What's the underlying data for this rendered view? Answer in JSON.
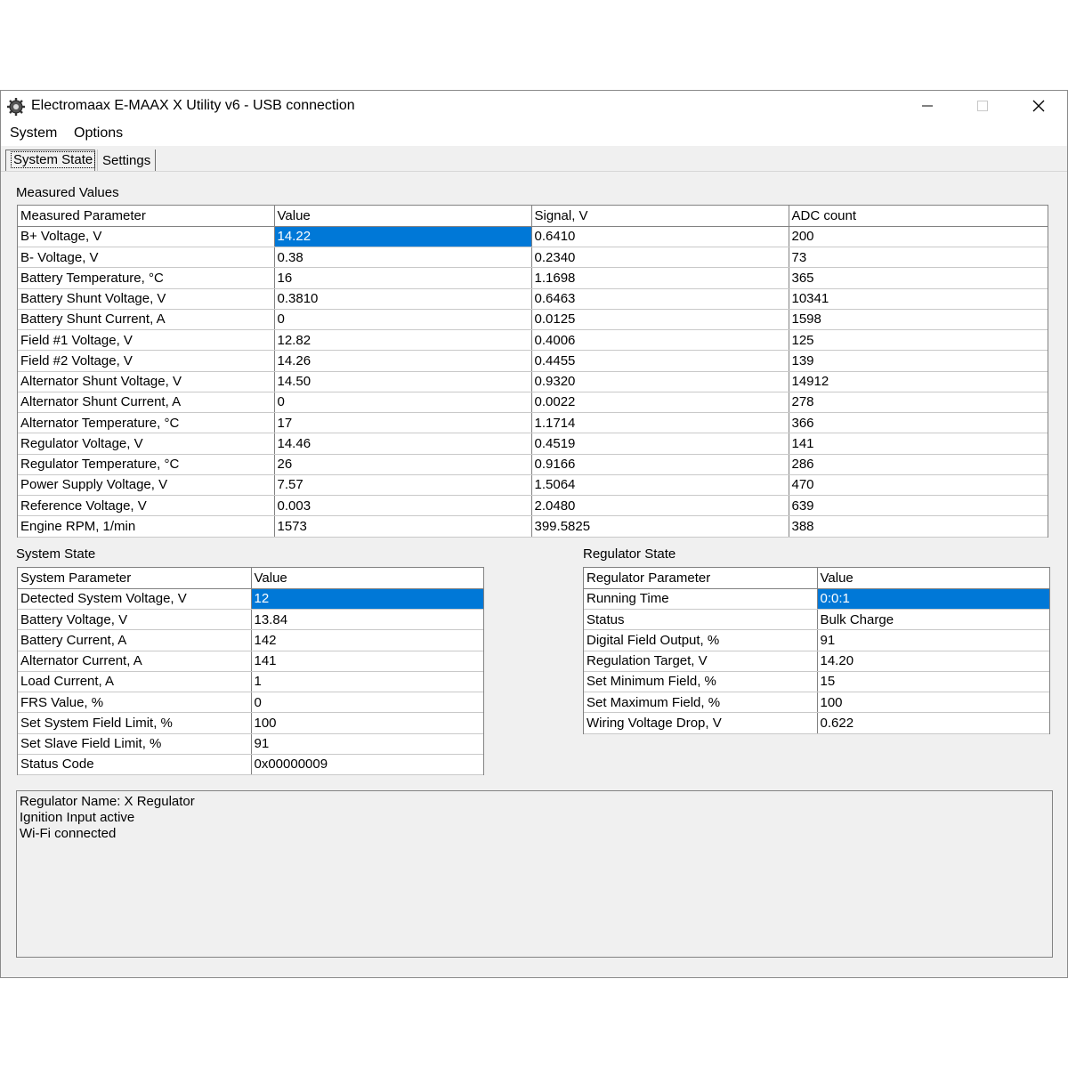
{
  "window": {
    "title": "Electromaax E-MAAX X Utility v6 - USB connection",
    "app_icon": "gear-icon"
  },
  "menu": {
    "items": [
      "System",
      "Options"
    ]
  },
  "tabs": {
    "active": "System State",
    "inactive": "Settings"
  },
  "measured": {
    "label": "Measured Values",
    "headers": [
      "Measured Parameter",
      "Value",
      "Signal, V",
      "ADC count"
    ],
    "rows": [
      [
        "B+ Voltage, V",
        "14.22",
        "0.6410",
        "200"
      ],
      [
        "B- Voltage, V",
        "0.38",
        "0.2340",
        "73"
      ],
      [
        "Battery Temperature, °C",
        "16",
        "1.1698",
        "365"
      ],
      [
        "Battery Shunt Voltage, V",
        "0.3810",
        "0.6463",
        "10341"
      ],
      [
        "Battery Shunt Current, A",
        "0",
        "0.0125",
        "1598"
      ],
      [
        "Field #1 Voltage, V",
        "12.82",
        "0.4006",
        "125"
      ],
      [
        "Field #2 Voltage, V",
        "14.26",
        "0.4455",
        "139"
      ],
      [
        "Alternator Shunt Voltage, V",
        "14.50",
        "0.9320",
        "14912"
      ],
      [
        "Alternator Shunt Current, A",
        "0",
        "0.0022",
        "278"
      ],
      [
        "Alternator Temperature, °C",
        "17",
        "1.1714",
        "366"
      ],
      [
        "Regulator Voltage, V",
        "14.46",
        "0.4519",
        "141"
      ],
      [
        "Regulator Temperature, °C",
        "26",
        "0.9166",
        "286"
      ],
      [
        "Power Supply Voltage, V",
        "7.57",
        "1.5064",
        "470"
      ],
      [
        "Reference Voltage, V",
        "0.003",
        "2.0480",
        "639"
      ],
      [
        "Engine RPM, 1/min",
        "1573",
        "399.5825",
        "388"
      ]
    ]
  },
  "system_state": {
    "label": "System State",
    "headers": [
      "System Parameter",
      "Value"
    ],
    "rows": [
      [
        "Detected System Voltage, V",
        "12"
      ],
      [
        "Battery Voltage, V",
        "13.84"
      ],
      [
        "Battery Current, A",
        "142"
      ],
      [
        "Alternator Current, A",
        "141"
      ],
      [
        "Load Current, A",
        "1"
      ],
      [
        "FRS Value, %",
        "0"
      ],
      [
        "Set System Field Limit, %",
        "100"
      ],
      [
        "Set Slave Field Limit, %",
        "91"
      ],
      [
        "Status Code",
        "0x00000009"
      ]
    ]
  },
  "regulator_state": {
    "label": "Regulator State",
    "headers": [
      "Regulator Parameter",
      "Value"
    ],
    "rows": [
      [
        "Running Time",
        "0:0:1"
      ],
      [
        "Status",
        "Bulk Charge"
      ],
      [
        "Digital Field Output, %",
        "91"
      ],
      [
        "Regulation Target, V",
        "14.20"
      ],
      [
        "Set Minimum Field, %",
        "15"
      ],
      [
        "Set Maximum Field, %",
        "100"
      ],
      [
        "Wiring Voltage Drop, V",
        "0.622"
      ]
    ]
  },
  "info": {
    "lines": [
      "Regulator Name: X Regulator",
      "Ignition Input active",
      "Wi-Fi connected"
    ]
  },
  "colors": {
    "selection": "#0078d7",
    "window_bg": "#f0f0f0"
  }
}
